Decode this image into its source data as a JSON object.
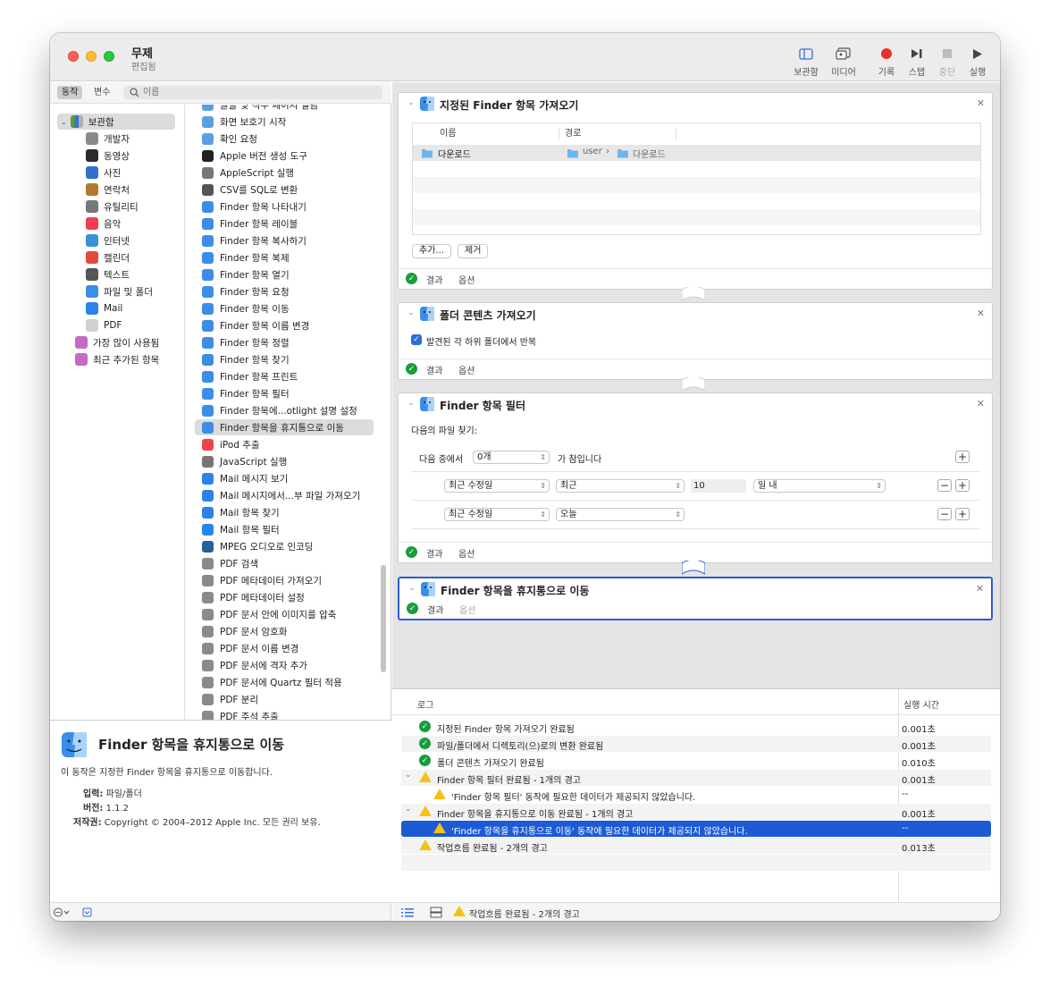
{
  "window": {
    "title": "무제",
    "subtitle": "편집됨"
  },
  "toolbar": [
    {
      "label": "보관함",
      "icon": "library-icon"
    },
    {
      "label": "미디어",
      "icon": "media-icon"
    },
    {
      "label": "기록",
      "icon": "record-icon"
    },
    {
      "label": "스텝",
      "icon": "step-icon"
    },
    {
      "label": "중단",
      "icon": "stop-icon"
    },
    {
      "label": "실행",
      "icon": "run-icon"
    }
  ],
  "filter": {
    "actions_tab": "동작",
    "variables_tab": "변수",
    "search_placeholder": "이름"
  },
  "library": {
    "root": "보관함",
    "items": [
      "개발자",
      "동영상",
      "사진",
      "연락처",
      "유틸리티",
      "음악",
      "인터넷",
      "캘린더",
      "텍스트",
      "파일 및 폴더",
      "Mail",
      "PDF"
    ],
    "extra": [
      "가장 많이 사용됨",
      "최근 추가된 항목"
    ]
  },
  "actions": [
    "글꼴 및 식주 페이지 열림",
    "화면 보호기 시작",
    "확인 요청",
    "Apple 버전 생성 도구",
    "AppleScript 실행",
    "CSV를 SQL로 변환",
    "Finder 항목 나타내기",
    "Finder 항목 레이블",
    "Finder 항목 복사하기",
    "Finder 항목 복제",
    "Finder 항목 열기",
    "Finder 항목 요청",
    "Finder 항목 이동",
    "Finder 항목 이름 변경",
    "Finder 항목 정렬",
    "Finder 항목 찾기",
    "Finder 항목 프린트",
    "Finder 항목 필터",
    "Finder 항목에...otlight 설명 설정",
    "Finder 항목을 휴지통으로 이동",
    "iPod 추출",
    "JavaScript 실행",
    "Mail 메시지 보기",
    "Mail 메시지에서...부 파일 가져오기",
    "Mail 항목 찾기",
    "Mail 항목 필터",
    "MPEG 오디오로 인코딩",
    "PDF 검색",
    "PDF 메타데이터 가져오기",
    "PDF 메타데이터 설정",
    "PDF 문서 안에 이미지를 압축",
    "PDF 문서 암호화",
    "PDF 문서 이름 변경",
    "PDF 문서에 격자 추가",
    "PDF 문서에 Quartz 필터 적용",
    "PDF 분리",
    "PDF 주석 추출"
  ],
  "description": {
    "title": "Finder 항목을 휴지통으로 이동",
    "text": "이 동작은 지정한 Finder 항목을 휴지통으로 이동합니다.",
    "input_label": "입력:",
    "input_value": "파일/폴더",
    "version_label": "버전:",
    "version_value": "1.1.2",
    "copyright_label": "저작권:",
    "copyright_value": "Copyright © 2004–2012 Apple Inc.  모든 권리 보유."
  },
  "workflow": {
    "step1": {
      "title": "지정된 Finder 항목 가져오기",
      "col_name": "이름",
      "col_path": "경로",
      "row_name": "다운로드",
      "row_path_user": "user",
      "row_path_sep": "›",
      "row_path_folder": "다운로드",
      "add": "추가...",
      "remove": "제거",
      "results": "결과",
      "options": "옵션"
    },
    "step2": {
      "title": "폴더 콘텐츠 가져오기",
      "checkbox": "발견된 각 하위 폴더에서 반복",
      "results": "결과",
      "options": "옵션"
    },
    "step3": {
      "title": "Finder 항목 필터",
      "find": "다음의 파일 찾기:",
      "any_of": "다음 중에서",
      "any_value": "0개",
      "is_true": "가 참입니다",
      "r1_field": "최근 수정일",
      "r1_op": "최근",
      "r1_num": "10",
      "r1_unit": "일 내",
      "r2_field": "최근 수정일",
      "r2_op": "오늘",
      "results": "결과",
      "options": "옵션"
    },
    "step4": {
      "title": "Finder 항목을 휴지통으로 이동",
      "results": "결과",
      "options": "옵션"
    }
  },
  "log": {
    "col_log": "로그",
    "col_time": "실행 시간",
    "rows": [
      {
        "text": "지정된 Finder 항목 가져오기 완료됨",
        "time": "0.001초",
        "status": "ok"
      },
      {
        "text": "파일/폴더에서 디렉토리(으)로의 변환 완료됨",
        "time": "0.001초",
        "status": "ok"
      },
      {
        "text": "폴더 콘텐츠 가져오기 완료됨",
        "time": "0.010초",
        "status": "ok"
      },
      {
        "text": "Finder 항목 필터 완료됨 - 1개의 경고",
        "time": "0.001초",
        "status": "warn"
      },
      {
        "text": "'Finder 항목 필터' 동작에 필요한 데이터가 제공되지 않았습니다.",
        "time": "--",
        "status": "warn"
      },
      {
        "text": "Finder 항목을 휴지통으로 이동 완료됨 - 1개의 경고",
        "time": "0.001초",
        "status": "warn"
      },
      {
        "text": "'Finder 항목을 휴지통으로 이동' 동작에 필요한 데이터가 제공되지 않았습니다.",
        "time": "--",
        "status": "warn"
      },
      {
        "text": "작업흐름 완료됨 - 2개의 경고",
        "time": "0.013초",
        "status": "warn"
      }
    ]
  },
  "status": {
    "text": "작업흐름 완료됨 - 2개의 경고"
  },
  "colors": {
    "accent": "#1c5ad6",
    "ok": "#1a9c3b",
    "warn": "#f5c211",
    "record": "#e5322d"
  }
}
